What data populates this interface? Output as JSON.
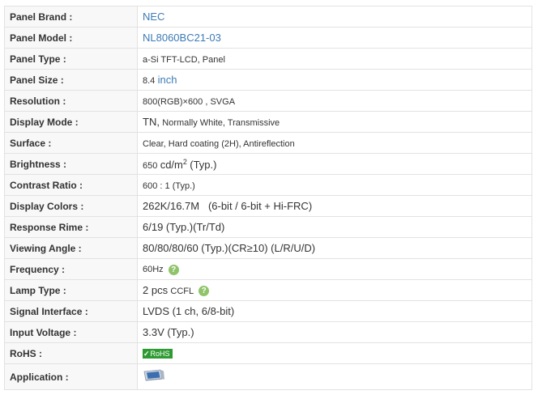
{
  "rows": [
    {
      "label": "Panel Brand :",
      "value": "NEC"
    },
    {
      "label": "Panel Model :",
      "value": "NL8060BC21-03"
    },
    {
      "label": "Panel Type :",
      "value": "a-Si TFT-LCD, Panel"
    },
    {
      "label": "Panel Size :",
      "value_num": "8.4",
      "value_unit": "inch"
    },
    {
      "label": "Resolution :",
      "value": "800(RGB)×600 , SVGA"
    },
    {
      "label": "Display Mode :",
      "value_main": "TN,",
      "value_rest": "Normally White, Transmissive"
    },
    {
      "label": "Surface :",
      "value": "Clear, Hard coating (2H), Antireflection"
    },
    {
      "label": "Brightness :",
      "value_num": "650",
      "value_unit": "cd/m",
      "value_sup": "2",
      "value_rest": "(Typ.)"
    },
    {
      "label": "Contrast Ratio :",
      "value": "600 : 1 (Typ.)"
    },
    {
      "label": "Display Colors :",
      "value": "262K/16.7M   (6-bit / 6-bit + Hi-FRC)"
    },
    {
      "label": "Response Rime :",
      "value": "6/19 (Typ.)(Tr/Td)"
    },
    {
      "label": "Viewing Angle :",
      "value": "80/80/80/60 (Typ.)(CR≥10) (L/R/U/D)"
    },
    {
      "label": "Frequency :",
      "value": "60Hz",
      "help": "?"
    },
    {
      "label": "Lamp Type :",
      "value_main": "2 pcs",
      "value_rest": "CCFL",
      "help": "?"
    },
    {
      "label": "Signal Interface :",
      "value": "LVDS (1 ch, 6/8-bit)"
    },
    {
      "label": "Input Voltage :",
      "value": "3.3V (Typ.)"
    },
    {
      "label": "RoHS :",
      "badge_check": "✓",
      "badge_text": "RoHS"
    },
    {
      "label": "Application :",
      "icon": "monitor-icon"
    }
  ]
}
